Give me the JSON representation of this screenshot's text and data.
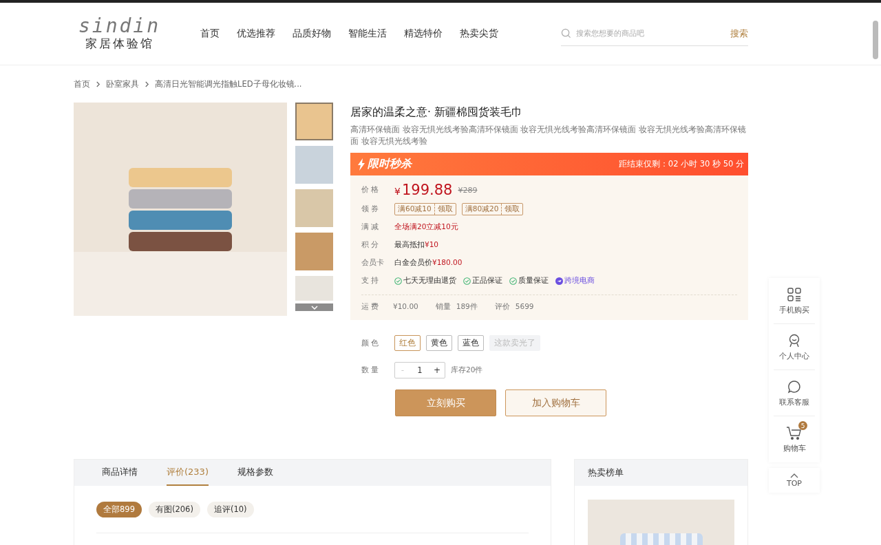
{
  "header": {
    "logo_text": "sindin",
    "logo_subtitle": "家居体验馆",
    "nav": [
      {
        "label": "首页"
      },
      {
        "label": "优选推荐"
      },
      {
        "label": "品质好物"
      },
      {
        "label": "智能生活"
      },
      {
        "label": "精选特价"
      },
      {
        "label": "热卖尖货"
      }
    ],
    "search": {
      "placeholder": "搜索您想要的商品吧",
      "button": "搜索"
    }
  },
  "breadcrumb": [
    "首页",
    "卧室家具",
    "高清日光智能调光指触LED子母化妆镜..."
  ],
  "gallery": {
    "thumbnails": [
      {
        "selected": true
      },
      {
        "selected": false
      },
      {
        "selected": false
      },
      {
        "selected": false
      },
      {
        "selected": false
      }
    ]
  },
  "product": {
    "title": "居家的温柔之意· 新疆棉囤货装毛巾",
    "subtitle": "高清环保镜面 妆容无惧光线考验高清环保镜面 妆容无惧光线考验高清环保镜面 妆容无惧光线考验高清环保镜面 妆容无惧光线考验",
    "flash": {
      "label": "限时秒杀",
      "countdown": "距结束仅剩：02 小时 30 秒 50 分"
    },
    "price": {
      "label": "价 格",
      "currency": "¥",
      "value": "199.88",
      "original": "¥289"
    },
    "coupons": {
      "label": "领 券",
      "items": [
        {
          "text": "满60减10",
          "action": "领取"
        },
        {
          "text": "满80减20",
          "action": "领取"
        }
      ]
    },
    "info_rows": [
      {
        "label": "满 减",
        "kind": "promo",
        "text": "全场满20立减10元"
      },
      {
        "label": "积 分",
        "kind": "amount",
        "text": "最高抵扣",
        "amount": "¥10"
      },
      {
        "label": "会员卡",
        "kind": "amount",
        "text": "白金会员价",
        "amount": "¥180.00"
      }
    ],
    "support": {
      "label": "支 持",
      "items": [
        {
          "text": "七天无理由退货",
          "kind": "check"
        },
        {
          "text": "正品保证",
          "kind": "check"
        },
        {
          "text": "质量保证",
          "kind": "check"
        },
        {
          "text": "跨境电商",
          "kind": "plane"
        }
      ]
    },
    "stats": [
      {
        "label": "运 费",
        "value": "¥10.00"
      },
      {
        "label": "销量",
        "value": "189件"
      },
      {
        "label": "评价",
        "value": "5699"
      }
    ],
    "colors": {
      "label": "颜 色",
      "options": [
        {
          "label": "红色",
          "selected": true,
          "disabled": false
        },
        {
          "label": "黄色",
          "selected": false,
          "disabled": false
        },
        {
          "label": "蓝色",
          "selected": false,
          "disabled": false
        },
        {
          "label": "这款卖光了",
          "selected": false,
          "disabled": true
        }
      ]
    },
    "quantity": {
      "label": "数 量",
      "minus": "-",
      "value": "1",
      "plus": "+",
      "minus_disabled": true,
      "stock": "库存20件"
    },
    "buy_button": "立刻购买",
    "cart_button": "加入购物车"
  },
  "float_bar": {
    "items": [
      {
        "label": "手机购买",
        "kind": "phone"
      },
      {
        "label": "个人中心",
        "kind": "user"
      },
      {
        "label": "联系客服",
        "kind": "chat"
      },
      {
        "label": "购物车",
        "kind": "cart",
        "badge": "5"
      }
    ],
    "top": "TOP"
  },
  "detail_tabs": [
    {
      "label": "商品详情",
      "selected": false
    },
    {
      "label": "评价(233)",
      "selected": true
    },
    {
      "label": "规格参数",
      "selected": false
    }
  ],
  "review_filters": [
    {
      "label": "全部899",
      "selected": true
    },
    {
      "label": "有图(206)",
      "selected": false
    },
    {
      "label": "追评(10)",
      "selected": false
    }
  ],
  "hot_list": {
    "title": "热卖榜单"
  }
}
